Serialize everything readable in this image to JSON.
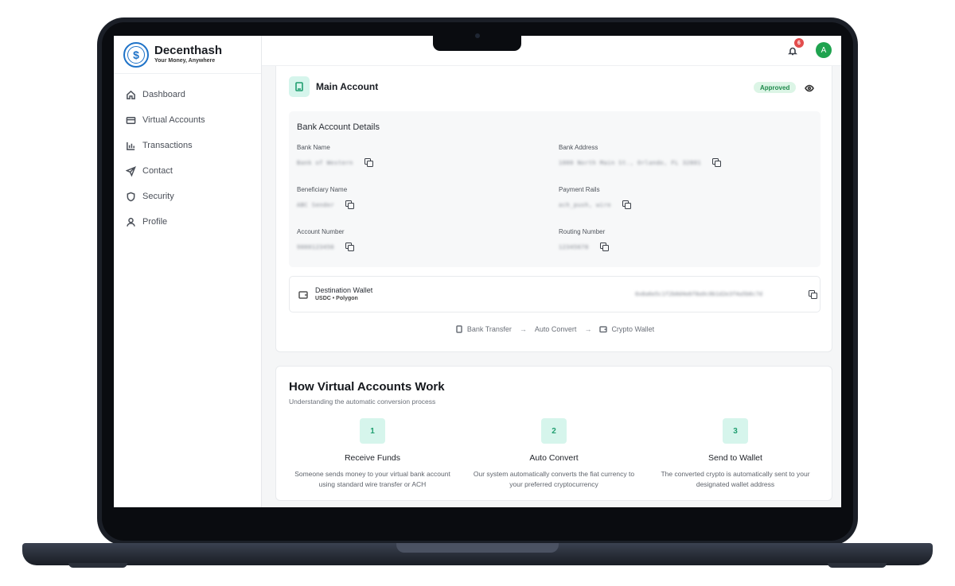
{
  "brand": {
    "name": "Decenthash",
    "tagline": "Your Money, Anywhere"
  },
  "sidebar": {
    "items": [
      {
        "label": "Dashboard",
        "icon": "home-icon"
      },
      {
        "label": "Virtual Accounts",
        "icon": "card-icon"
      },
      {
        "label": "Transactions",
        "icon": "chart-icon"
      },
      {
        "label": "Contact",
        "icon": "send-icon"
      },
      {
        "label": "Security",
        "icon": "shield-icon"
      },
      {
        "label": "Profile",
        "icon": "user-icon"
      }
    ]
  },
  "header": {
    "notification_count": "6",
    "avatar_initial": "A"
  },
  "account": {
    "title": "Main Account",
    "status": "Approved",
    "details_title": "Bank Account Details",
    "fields": [
      {
        "label": "Bank Name",
        "value": "Bank of Western"
      },
      {
        "label": "Bank Address",
        "value": "1000 North Main St., Orlando, FL 32801"
      },
      {
        "label": "Beneficiary Name",
        "value": "ABC Sender"
      },
      {
        "label": "Payment Rails",
        "value": "ach_push, wire"
      },
      {
        "label": "Account Number",
        "value": "9000123456"
      },
      {
        "label": "Routing Number",
        "value": "12345678"
      }
    ],
    "wallet": {
      "name": "Destination Wallet",
      "network": "USDC • Polygon",
      "address": "0x8a6e5c1f2b0d4e6f8a9c0b1d2e3f4a5b6c7d"
    },
    "flow": {
      "step1": "Bank Transfer",
      "step2": "Auto Convert",
      "step3": "Crypto Wallet"
    }
  },
  "how": {
    "title": "How Virtual Accounts Work",
    "subtitle": "Understanding the automatic conversion process",
    "steps": [
      {
        "num": "1",
        "title": "Receive Funds",
        "desc": "Someone sends money to your virtual bank account using standard wire transfer or ACH"
      },
      {
        "num": "2",
        "title": "Auto Convert",
        "desc": "Our system automatically converts the fiat currency to your preferred cryptocurrency"
      },
      {
        "num": "3",
        "title": "Send to Wallet",
        "desc": "The converted crypto is automatically sent to your designated wallet address"
      }
    ]
  },
  "colors": {
    "accent": "#1f9e6f",
    "brand": "#1f73c8",
    "approved": "#1f8a4c",
    "badge": "#e34d4d",
    "avatar": "#1fa34f"
  }
}
